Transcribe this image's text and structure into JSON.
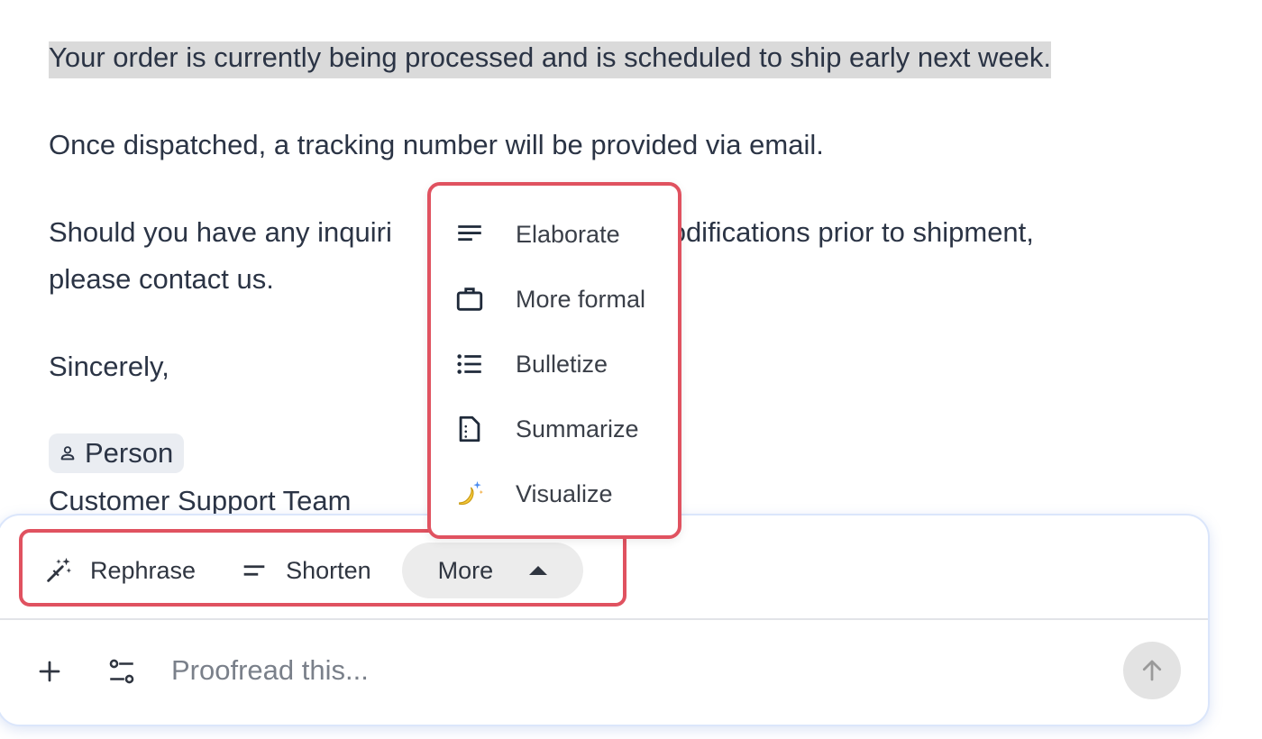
{
  "document": {
    "paragraph1": "Your order is currently being processed and is scheduled to ship early next week.",
    "paragraph2": "Once dispatched, a tracking number will be provided via email.",
    "paragraph3_line1_start": "Should you have any inquiri",
    "paragraph3_line1_end": "modifications prior to shipment,",
    "paragraph3_line2": "please contact us.",
    "closing": "Sincerely,",
    "person_chip": "Person",
    "signature": "Customer Support Team"
  },
  "actions": {
    "rephrase": "Rephrase",
    "shorten": "Shorten",
    "more": "More"
  },
  "menu": {
    "items": [
      {
        "label": "Elaborate",
        "icon": "lines-icon"
      },
      {
        "label": "More formal",
        "icon": "briefcase-icon"
      },
      {
        "label": "Bulletize",
        "icon": "bullet-list-icon"
      },
      {
        "label": "Summarize",
        "icon": "document-icon"
      },
      {
        "label": "Visualize",
        "icon": "banana-sparkle-icon"
      }
    ]
  },
  "composer": {
    "placeholder": "Proofread this..."
  },
  "colors": {
    "highlight_border": "#e05260",
    "text_highlight": "#dadada",
    "chip_background": "#eaedf2"
  }
}
